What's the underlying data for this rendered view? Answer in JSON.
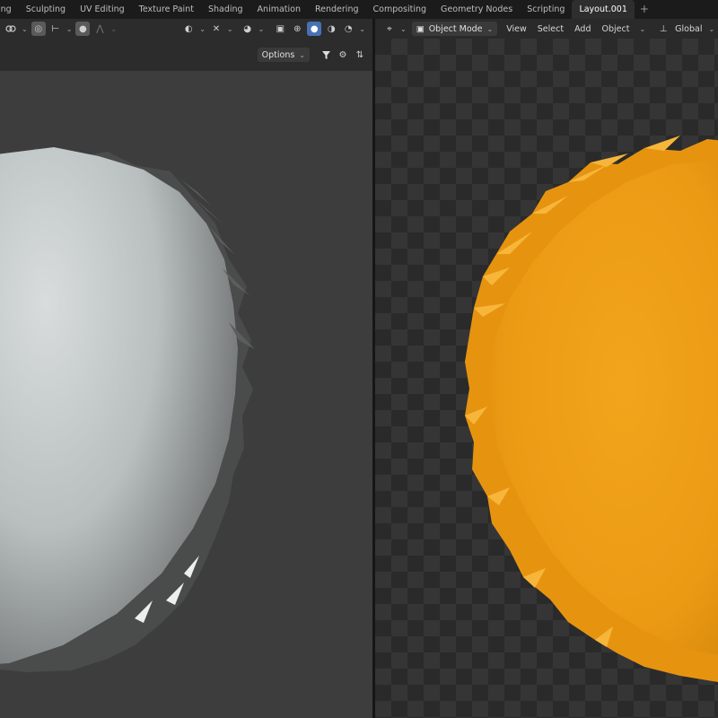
{
  "workspace_tabs": [
    "ing",
    "Sculpting",
    "UV Editing",
    "Texture Paint",
    "Shading",
    "Animation",
    "Rendering",
    "Compositing",
    "Geometry Nodes",
    "Scripting",
    "Layout.001"
  ],
  "active_tab": "Layout.001",
  "add_tab_symbol": "+",
  "left_viewport": {
    "options_label": "Options",
    "object_color": "#c8cccc"
  },
  "right_viewport": {
    "mode_label": "Object Mode",
    "menus": [
      "View",
      "Select",
      "Add",
      "Object"
    ],
    "transform_orientation": "Global",
    "object_color": "#f0a21c"
  },
  "colors": {
    "accent": "#4772b3",
    "header_bg": "#2c2c2c",
    "viewport_bg": "#3d3d3d",
    "active_tab_bg": "#2e2e2e"
  }
}
